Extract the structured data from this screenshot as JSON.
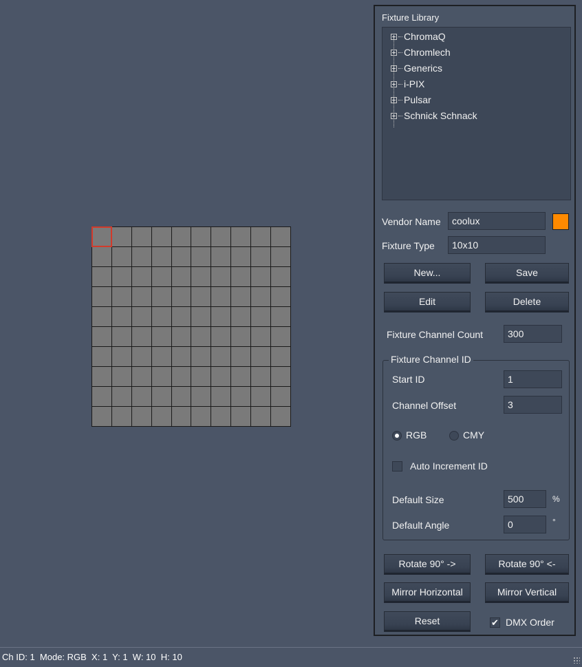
{
  "fixture_grid": {
    "columns": 10,
    "rows": 10,
    "selected_cell": 1,
    "colors": {
      "cell": "#7a7a7a",
      "border": "#1a1a1a",
      "selected": "#d23a2a"
    }
  },
  "library": {
    "title": "Fixture Library",
    "items": [
      {
        "label": "ChromaQ"
      },
      {
        "label": "Chromlech"
      },
      {
        "label": "Generics"
      },
      {
        "label": "i-PIX"
      },
      {
        "label": "Pulsar"
      },
      {
        "label": "Schnick Schnack"
      }
    ]
  },
  "vendor": {
    "label": "Vendor Name",
    "value": "coolux",
    "color": "#ff8a00"
  },
  "fixture_type": {
    "label": "Fixture Type",
    "value": "10x10"
  },
  "buttons": {
    "new": "New...",
    "save": "Save",
    "edit": "Edit",
    "delete": "Delete",
    "rotate_cw": "Rotate 90° ->",
    "rotate_ccw": "Rotate 90° <-",
    "mirror_h": "Mirror Horizontal",
    "mirror_v": "Mirror Vertical",
    "reset": "Reset"
  },
  "channel_count": {
    "label": "Fixture Channel Count",
    "value": "300"
  },
  "channel_id": {
    "group_title": "Fixture Channel ID",
    "start_id": {
      "label": "Start ID",
      "value": "1"
    },
    "channel_offset": {
      "label": "Channel Offset",
      "value": "3"
    },
    "mode": {
      "rgb": "RGB",
      "cmy": "CMY",
      "selected": "RGB"
    },
    "auto_increment": {
      "label": "Auto Increment ID",
      "checked": false
    },
    "default_size": {
      "label": "Default Size",
      "value": "500",
      "unit": "%"
    },
    "default_angle": {
      "label": "Default Angle",
      "value": "0",
      "unit": "°"
    }
  },
  "dmx_order": {
    "label": "DMX Order",
    "checked": true
  },
  "status": "Ch ID: 1  Mode: RGB  X: 1  Y: 1  W: 10  H: 10"
}
